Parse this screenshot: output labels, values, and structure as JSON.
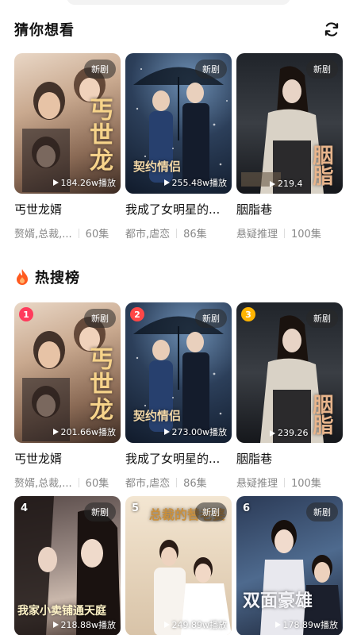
{
  "colors": {
    "rank1": "#ff3b5c",
    "rank2": "#ff4747",
    "rank3": "#ffb400",
    "fire": "#ff5a1f"
  },
  "guess": {
    "title": "猜你想看",
    "refresh_icon": "refresh-icon",
    "items": [
      {
        "title": "丐世龙婿",
        "tags": "赘婿,总裁,...",
        "episodes": "60集",
        "badge": "新剧",
        "plays": "184.26w播放",
        "poster_text": "丐世龙"
      },
      {
        "title": "我成了女明星的...",
        "tags": "都市,虐恋",
        "episodes": "86集",
        "badge": "新剧",
        "plays": "255.48w播放",
        "poster_text": "契约情侣"
      },
      {
        "title": "胭脂巷",
        "tags": "悬疑推理",
        "episodes": "100集",
        "badge": "新剧",
        "plays": "219.4",
        "poster_text": "胭脂"
      }
    ]
  },
  "hot": {
    "title": "热搜榜",
    "fire_icon": "fire-icon",
    "items": [
      {
        "rank": "1",
        "title": "丐世龙婿",
        "tags": "赘婿,总裁,...",
        "episodes": "60集",
        "badge": "新剧",
        "plays": "201.66w播放",
        "poster_text": "丐世龙"
      },
      {
        "rank": "2",
        "title": "我成了女明星的...",
        "tags": "都市,虐恋",
        "episodes": "86集",
        "badge": "新剧",
        "plays": "273.00w播放",
        "poster_text": "契约情侣"
      },
      {
        "rank": "3",
        "title": "胭脂巷",
        "tags": "悬疑推理",
        "episodes": "100集",
        "badge": "新剧",
        "plays": "239.26",
        "poster_text": "胭脂"
      },
      {
        "rank": "4",
        "badge": "新剧",
        "plays": "218.88w播放",
        "poster_text": "我家小卖铺通天庭"
      },
      {
        "rank": "5",
        "badge": "新剧",
        "plays": "249.89w播放",
        "poster_text": "总裁的替老婆"
      },
      {
        "rank": "6",
        "badge": "新剧",
        "plays": "178.89w播放",
        "poster_text": "双面豪雄"
      }
    ]
  }
}
